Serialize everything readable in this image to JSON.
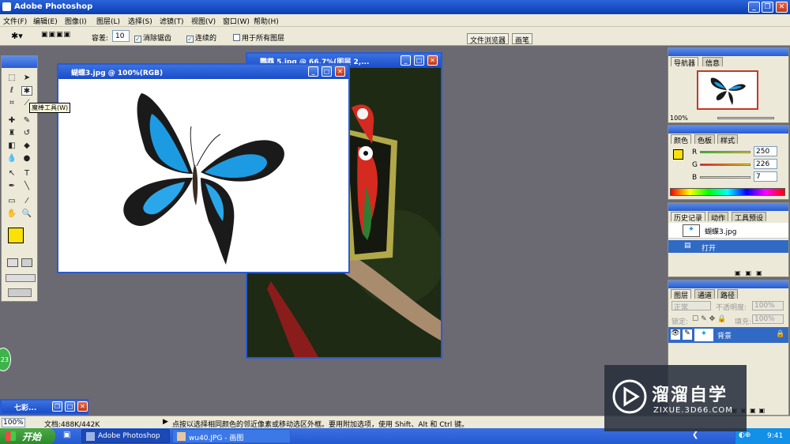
{
  "app": {
    "title": "Adobe Photoshop"
  },
  "menu": [
    "文件(F)",
    "编辑(E)",
    "图像(I)",
    "图层(L)",
    "选择(S)",
    "滤镜(T)",
    "视图(V)",
    "窗口(W)",
    "帮助(H)"
  ],
  "options": {
    "tolerance_label": "容差:",
    "tolerance_value": "10",
    "antialias_label": "消除锯齿",
    "contiguous_label": "连续的",
    "all_layers_label": "用于所有图层",
    "tab_file_browser": "文件浏览器",
    "tab_brushes": "画笔"
  },
  "toolbox": {
    "tooltip": "魔棒工具(W)"
  },
  "doc_front": {
    "title": "蝴蝶3.jpg @ 100%(RGB)"
  },
  "doc_back": {
    "title": "鹦鹉 5.jpg @ 66.7%(图层 2,..."
  },
  "minimized_doc": {
    "title": "七彩..."
  },
  "navigator": {
    "tab1": "导航器",
    "tab2": "信息",
    "zoom": "100%"
  },
  "color_panel": {
    "tab1": "颜色",
    "tab2": "色板",
    "tab3": "样式",
    "r_label": "R",
    "g_label": "G",
    "b_label": "B",
    "r": "250",
    "g": "226",
    "b": "7",
    "fg_color": "#fae207"
  },
  "history": {
    "tab1": "历史记录",
    "tab2": "动作",
    "tab3": "工具预设",
    "snapshot": "蝴蝶3.jpg",
    "step": "打开"
  },
  "layers": {
    "tab1": "图层",
    "tab2": "通道",
    "tab3": "路径",
    "blend_mode": "正常",
    "opacity_label": "不透明度:",
    "opacity": "100%",
    "lock_label": "锁定:",
    "fill_label": "填充:",
    "fill": "100%",
    "layer_name": "背景"
  },
  "status": {
    "zoom": "100%",
    "doc_size": "文档:488K/442K",
    "hint": "点按以选择相同颜色的邻近像素或移动选区外框。要用附加选项，使用 Shift、Alt 和 Ctrl 键。"
  },
  "taskbar": {
    "start": "开始",
    "task1": "Adobe Photoshop",
    "task2": "wu40.JPG - 画图",
    "time": "9:41"
  },
  "badge": "23",
  "watermark": {
    "brand": "溜溜自学",
    "url": "ZIXUE.3D66.COM"
  }
}
